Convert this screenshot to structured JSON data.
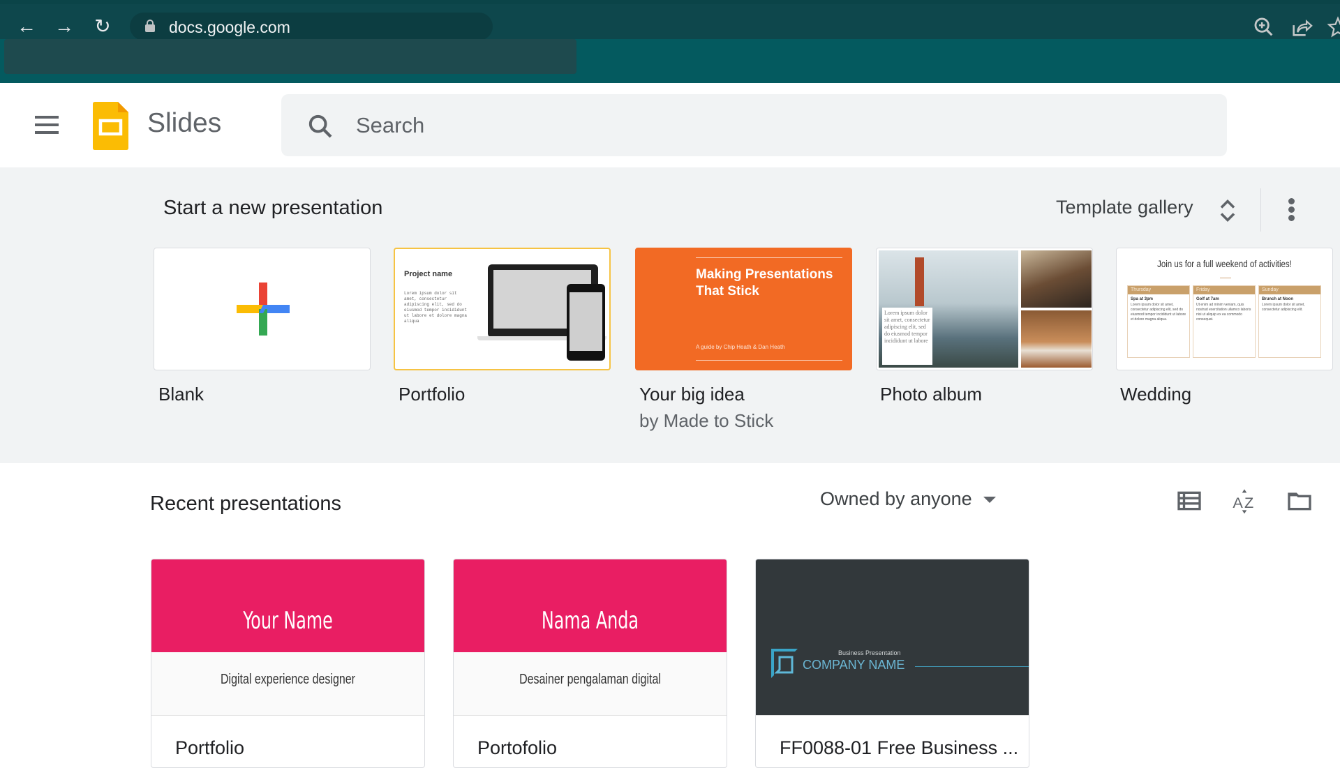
{
  "browser": {
    "url": "docs.google.com",
    "buttons": {
      "back": "back-icon",
      "forward": "forward-icon",
      "reload": "reload-icon",
      "zoom": "zoom-in-icon",
      "share": "share-icon",
      "bookmark": "star-icon"
    },
    "colors": {
      "toolbar": "#0e474c",
      "frame": "#045a5f"
    }
  },
  "header": {
    "menu_icon": "hamburger-menu-icon",
    "app_name": "Slides",
    "search_placeholder": "Search",
    "logo_color": "#fbbc04"
  },
  "templates": {
    "section_title": "Start a new presentation",
    "gallery_label": "Template gallery",
    "items": [
      {
        "label": "Blank"
      },
      {
        "label": "Portfolio",
        "thumb_title": "Project name",
        "thumb_text": "Lorem ipsum dolor sit amet, consectetur adipiscing elit, sed do eiusmod tempor incididunt ut labore et dolore magna aliqua"
      },
      {
        "label": "Your big idea",
        "sublabel": "by Made to Stick",
        "thumb_title": "Making Presentations That Stick",
        "thumb_sub": "A guide by Chip Heath & Dan Heath"
      },
      {
        "label": "Photo album",
        "thumb_text": "Lorem ipsum dolor sit amet, consectetur adipiscing elit, sed do eiusmod tempor incididunt ut labore"
      },
      {
        "label": "Wedding",
        "thumb_title": "Join us for a full weekend of activities!",
        "days": [
          {
            "day": "Thursday",
            "event": "Spa at 3pm",
            "text": "Lorem ipsum dolor sit amet, consectetur adipiscing elit, sed do eiusmod tempor incididunt ut labore et dolore magna aliqua."
          },
          {
            "day": "Friday",
            "event": "Golf at 7am",
            "text": "Ut enim ad minim veniam, quis nostrud exercitation ullamco laboris nisi ut aliquip ex ea commodo consequat."
          },
          {
            "day": "Sunday",
            "event": "Brunch at Noon",
            "text": "Lorem ipsum dolor sit amet, consectetur adipiscing elit."
          }
        ]
      }
    ]
  },
  "recent": {
    "section_title": "Recent presentations",
    "owner_filter": "Owned by anyone",
    "view_icons": [
      "list-view-icon",
      "sort-az-icon",
      "folder-icon"
    ],
    "docs": [
      {
        "name": "Portfolio",
        "thumb_title": "Your Name",
        "thumb_sub": "Digital experience designer"
      },
      {
        "name": "Portofolio",
        "thumb_title": "Nama Anda",
        "thumb_sub": "Desainer pengalaman digital"
      },
      {
        "name": "FF0088-01 Free Business ...",
        "thumb_small": "Business Presentation",
        "thumb_title": "COMPANY NAME"
      }
    ]
  }
}
